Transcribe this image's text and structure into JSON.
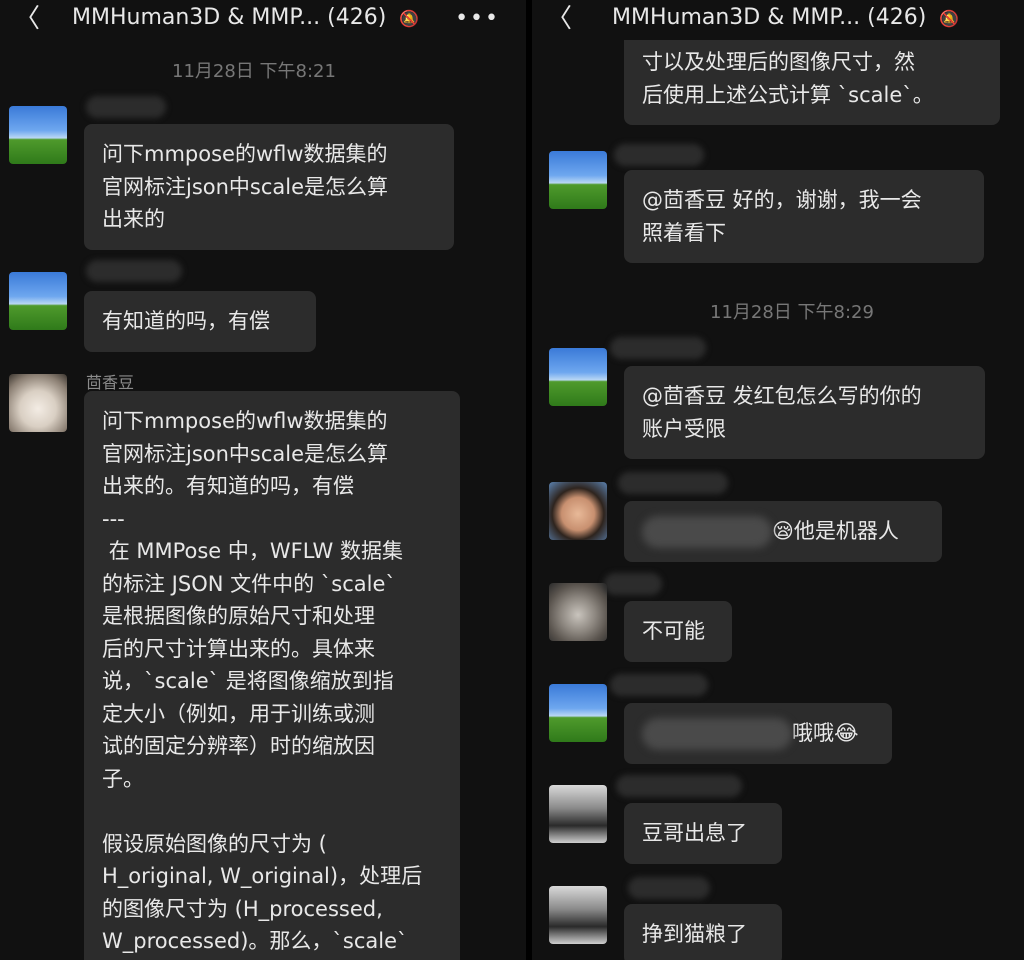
{
  "chat": {
    "title": "MMHuman3D & MMP...",
    "count": "(426)",
    "mute_icon": "bell-off-icon",
    "back_icon": "chevron-left-icon",
    "more_icon": "more-horizontal-icon",
    "more_glyph": "•••",
    "back_glyph": "〈"
  },
  "left": {
    "time": "11月28日 下午8:21",
    "messages": [
      {
        "text": "问下mmpose的wflw数据集的\n官网标注json中scale是怎么算\n出来的"
      },
      {
        "text": "有知道的吗，有偿"
      },
      {
        "sender": "茴香豆",
        "text": "问下mmpose的wflw数据集的\n官网标注json中scale是怎么算\n出来的。有知道的吗，有偿\n---\n 在 MMPose 中，WFLW 数据集\n的标注 JSON 文件中的 `scale`\n是根据图像的原始尺寸和处理\n后的尺寸计算出来的。具体来\n说，`scale` 是将图像缩放到指\n定大小（例如，用于训练或测\n试的固定分辨率）时的缩放因\n子。\n\n假设原始图像的尺寸为 (\nH_original, W_original)，处理后\n的图像尺寸为 (H_processed,\nW_processed)。那么，`scale`"
      }
    ]
  },
  "right": {
    "messages_top": [
      {
        "text": "寸以及处理后的图像尺寸，然\n后使用上述公式计算 `scale`。"
      },
      {
        "text": "@茴香豆 好的，谢谢，我一会\n照着看下"
      }
    ],
    "time": "11月28日 下午8:29",
    "messages_bottom": [
      {
        "text": "@茴香豆 发红包怎么写的你的\n账户受限"
      },
      {
        "text": "😪他是机器人"
      },
      {
        "text": "不可能"
      },
      {
        "text": "哦哦😂"
      },
      {
        "text": "豆哥出息了"
      },
      {
        "text": "挣到猫粮了"
      }
    ]
  }
}
